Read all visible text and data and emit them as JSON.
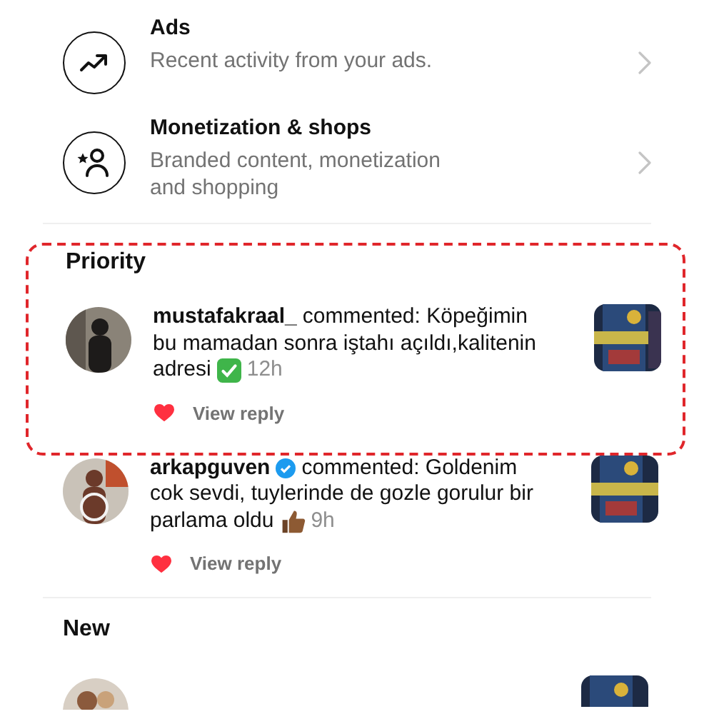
{
  "menu_rows": [
    {
      "title": "Ads",
      "subtitle": "Recent activity from your ads."
    },
    {
      "title": "Monetization & shops",
      "subtitle": "Branded content, monetization and shopping"
    }
  ],
  "priority": {
    "heading": "Priority",
    "highlighted": true,
    "items": [
      {
        "username": "mustafakraal_",
        "verified": false,
        "text_lines": [
          "commented: Köpeğimin",
          "bu mamadan sonra iştahı açıldı,kalitenin",
          "adresi"
        ],
        "time": "12h",
        "liked": true,
        "reply_link": "View reply",
        "highlighted": true
      },
      {
        "username": "arkapguven",
        "verified": true,
        "text_lines": [
          "commented: Goldenim",
          "cok sevdi, tuylerinde de gozle gorulur bir",
          "parlama oldu"
        ],
        "time": "9h",
        "liked": true,
        "reply_link": "View reply",
        "highlighted": false
      }
    ]
  },
  "new_section": {
    "heading": "New"
  }
}
